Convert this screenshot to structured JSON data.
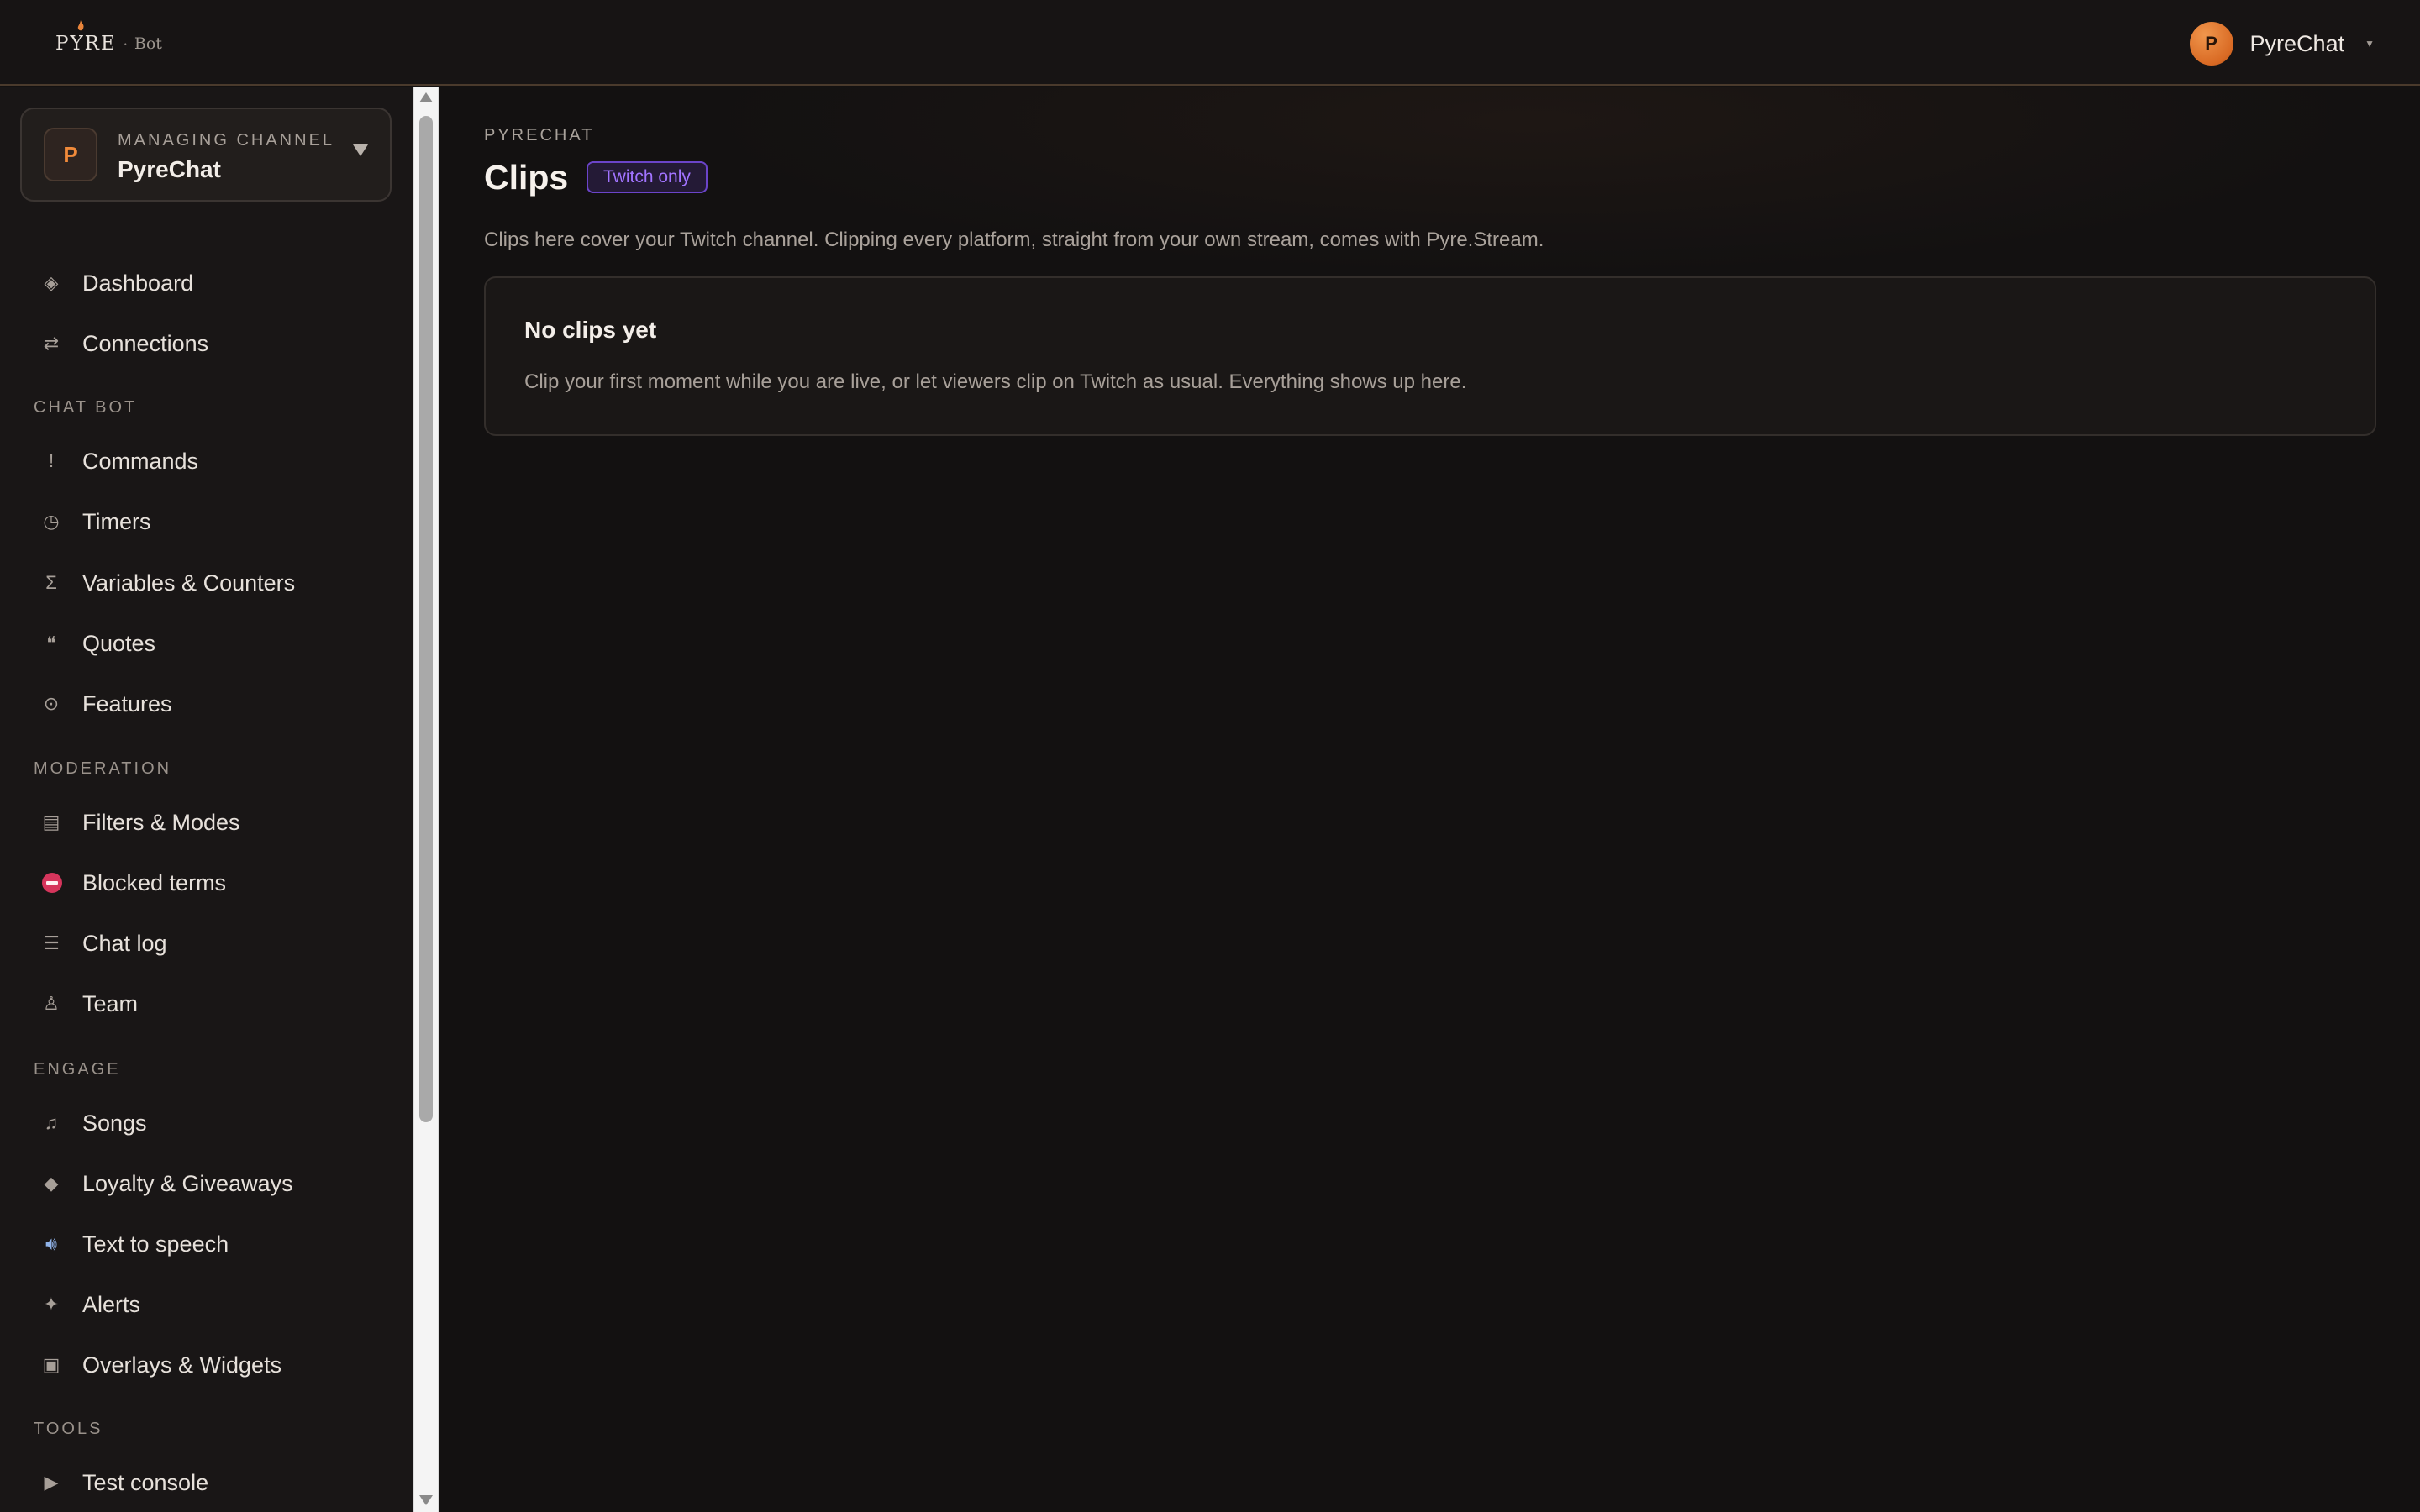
{
  "brand": {
    "wordmark": "PYRE",
    "separator": "·",
    "product": "Bot",
    "accent_color": "#e8843a"
  },
  "user": {
    "avatar_initial": "P",
    "name": "PyreChat"
  },
  "channel": {
    "label": "MANAGING CHANNEL",
    "name": "PyreChat",
    "avatar_initial": "P"
  },
  "sidebar": {
    "top_items": [
      {
        "label": "Dashboard",
        "icon": "diamond-icon"
      },
      {
        "label": "Connections",
        "icon": "swap-arrows-icon"
      }
    ],
    "sections": [
      {
        "title": "CHAT BOT",
        "items": [
          {
            "label": "Commands",
            "icon": "exclamation-icon"
          },
          {
            "label": "Timers",
            "icon": "clock-icon"
          },
          {
            "label": "Variables & Counters",
            "icon": "sigma-icon"
          },
          {
            "label": "Quotes",
            "icon": "quote-icon"
          },
          {
            "label": "Features",
            "icon": "target-icon"
          }
        ]
      },
      {
        "title": "MODERATION",
        "items": [
          {
            "label": "Filters & Modes",
            "icon": "filter-icon"
          },
          {
            "label": "Blocked terms",
            "icon": "no-entry-icon"
          },
          {
            "label": "Chat log",
            "icon": "lines-icon"
          },
          {
            "label": "Team",
            "icon": "person-icon"
          }
        ]
      },
      {
        "title": "ENGAGE",
        "items": [
          {
            "label": "Songs",
            "icon": "music-note-icon"
          },
          {
            "label": "Loyalty & Giveaways",
            "icon": "gem-icon"
          },
          {
            "label": "Text to speech",
            "icon": "speaker-icon"
          },
          {
            "label": "Alerts",
            "icon": "sparkle-icon"
          },
          {
            "label": "Overlays & Widgets",
            "icon": "square-icon"
          }
        ]
      },
      {
        "title": "TOOLS",
        "items": [
          {
            "label": "Test console",
            "icon": "play-icon"
          }
        ]
      }
    ]
  },
  "page": {
    "eyebrow": "PYRECHAT",
    "title": "Clips",
    "badge": "Twitch only",
    "description": "Clips here cover your Twitch channel. Clipping every platform, straight from your own stream, comes with Pyre.Stream.",
    "empty_title": "No clips yet",
    "empty_text": "Clip your first moment while you are live, or let viewers clip on Twitch as usual. Everything shows up here."
  }
}
